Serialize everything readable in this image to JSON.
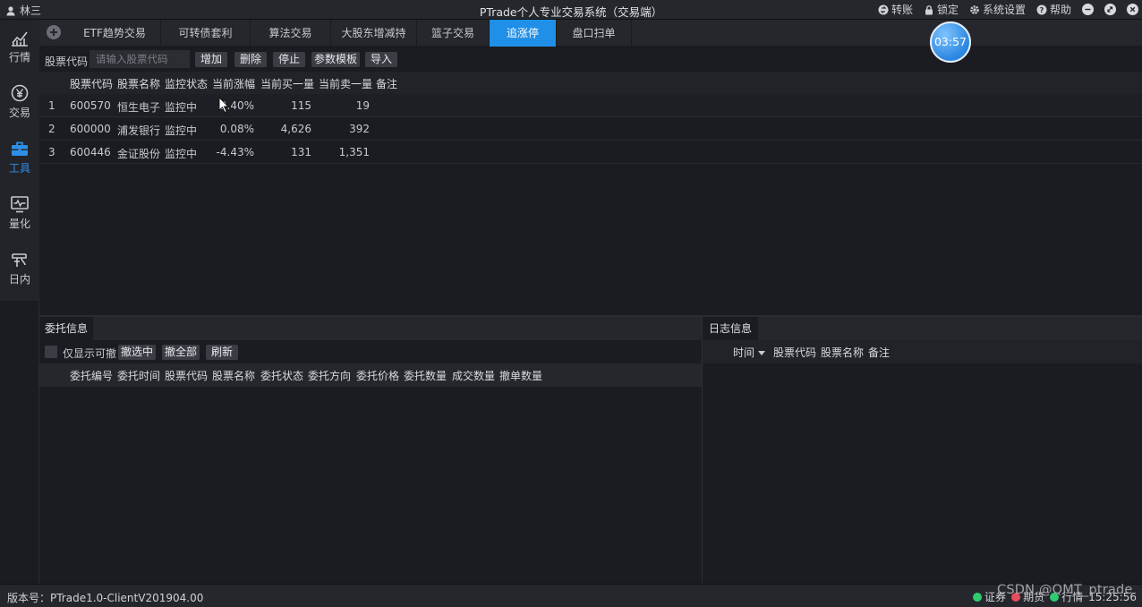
{
  "app": {
    "user": "林三",
    "title": "PTrade个人专业交易系统（交易端）",
    "title_actions": [
      {
        "label": "转账",
        "icon": "transfer-icon"
      },
      {
        "label": "锁定",
        "icon": "lock-icon"
      },
      {
        "label": "系统设置",
        "icon": "gear-icon"
      },
      {
        "label": "帮助",
        "icon": "help-icon"
      }
    ]
  },
  "sidebar": {
    "items": [
      {
        "label": "行情",
        "icon": "chart-line-icon",
        "active": false
      },
      {
        "label": "交易",
        "icon": "yen-icon",
        "active": false
      },
      {
        "label": "工具",
        "icon": "toolbox-icon",
        "active": true
      },
      {
        "label": "量化",
        "icon": "monitor-pulse-icon",
        "active": false
      },
      {
        "label": "日内",
        "icon": "intraday-icon",
        "active": false
      }
    ]
  },
  "tabs": [
    {
      "label": "ETF趋势交易",
      "active": false
    },
    {
      "label": "可转债套利",
      "active": false
    },
    {
      "label": "算法交易",
      "active": false
    },
    {
      "label": "大股东增减持",
      "active": false
    },
    {
      "label": "篮子交易",
      "active": false
    },
    {
      "label": "追涨停",
      "active": true
    },
    {
      "label": "盘口扫单",
      "active": false
    }
  ],
  "clock": "03:57",
  "toolbar": {
    "code_label": "股票代码",
    "code_placeholder": "请输入股票代码",
    "buttons": [
      "增加",
      "删除",
      "停止",
      "参数模板",
      "导入"
    ]
  },
  "main_table": {
    "columns": [
      "股票代码",
      "股票名称",
      "监控状态",
      "当前涨幅",
      "当前买一量",
      "当前卖一量",
      "备注"
    ],
    "rows": [
      {
        "idx": "1",
        "code": "600570",
        "name": "恒生电子",
        "status": "监控中",
        "change": "2.40%",
        "bid1": "115",
        "ask1": "19",
        "note": ""
      },
      {
        "idx": "2",
        "code": "600000",
        "name": "浦发银行",
        "status": "监控中",
        "change": "0.08%",
        "bid1": "4,626",
        "ask1": "392",
        "note": ""
      },
      {
        "idx": "3",
        "code": "600446",
        "name": "金证股份",
        "status": "监控中",
        "change": "-4.43%",
        "bid1": "131",
        "ask1": "1,351",
        "note": ""
      }
    ]
  },
  "orders_panel": {
    "title": "委托信息",
    "only_cancellable_label": "仅显示可撤",
    "buttons": [
      "撤选中",
      "撤全部",
      "刷新"
    ],
    "columns": [
      "委托编号",
      "委托时间",
      "股票代码",
      "股票名称",
      "委托状态",
      "委托方向",
      "委托价格",
      "委托数量",
      "成交数量",
      "撤单数量"
    ]
  },
  "log_panel": {
    "title": "日志信息",
    "columns": [
      "时间",
      "股票代码",
      "股票名称",
      "备注"
    ]
  },
  "statusbar": {
    "version": "版本号：PTrade1.0-ClientV201904.00",
    "indicators": [
      {
        "label": "证券",
        "color": "#2ecc71"
      },
      {
        "label": "期货",
        "color": "#e74c5c"
      },
      {
        "label": "行情",
        "color": "#2ecc71"
      }
    ],
    "time": "15:25:56",
    "watermark": "CSDN @QMT_ptrade"
  }
}
